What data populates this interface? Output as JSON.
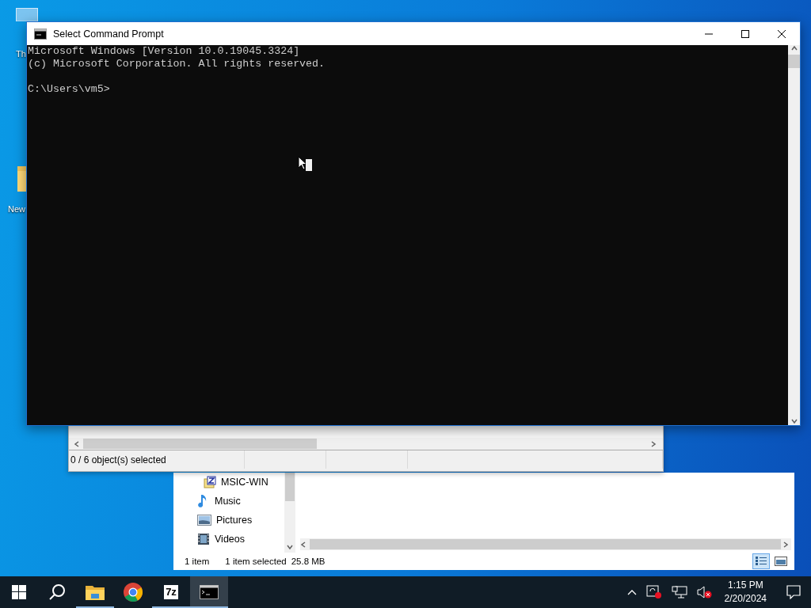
{
  "desktop_icons": [
    {
      "kind": "pc",
      "label": "Th"
    },
    {
      "kind": "folder",
      "label": "New"
    }
  ],
  "cmd_window": {
    "title": "Select Command Prompt",
    "lines": [
      "Microsoft Windows [Version 10.0.19045.3324]",
      "(c) Microsoft Corporation. All rights reserved."
    ],
    "prompt": "C:\\Users\\vm5>"
  },
  "middle_window": {
    "status": "0 / 6 object(s) selected"
  },
  "explorer": {
    "nav_items": [
      {
        "kind": "drive",
        "label": "MSIC-WIN"
      },
      {
        "kind": "music",
        "label": "Music"
      },
      {
        "kind": "pictures",
        "label": "Pictures"
      },
      {
        "kind": "videos",
        "label": "Videos"
      }
    ],
    "item_count": "1 item",
    "selection": "1 item selected",
    "size": "25.8 MB",
    "views": [
      {
        "kind": "details",
        "selected": true
      },
      {
        "kind": "tiles",
        "selected": false
      }
    ]
  },
  "taskbar": {
    "apps": [
      {
        "kind": "files",
        "running": true,
        "active": false
      },
      {
        "kind": "browser",
        "running": false,
        "active": false
      },
      {
        "kind": "archiver",
        "label": "7z",
        "running": true,
        "active": false
      },
      {
        "kind": "terminal",
        "running": true,
        "active": true
      }
    ],
    "time": "1:15 PM",
    "date": "2/20/2024"
  }
}
